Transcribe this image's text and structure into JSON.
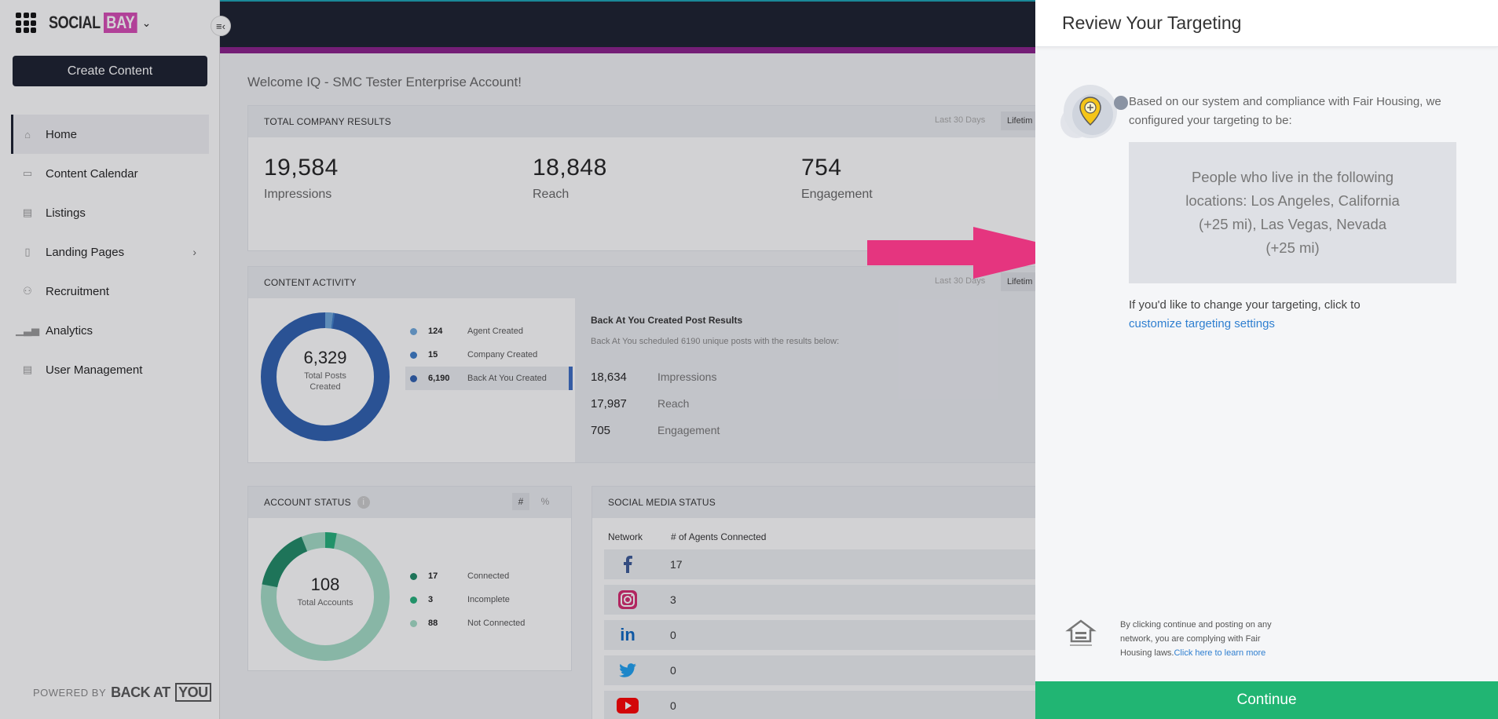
{
  "brand": {
    "name": "SOCIAL",
    "name_accent": "BAY"
  },
  "sidebar": {
    "create_label": "Create Content",
    "items": [
      {
        "label": "Home",
        "icon": "home-icon"
      },
      {
        "label": "Content Calendar",
        "icon": "calendar-icon"
      },
      {
        "label": "Listings",
        "icon": "listings-icon"
      },
      {
        "label": "Landing Pages",
        "icon": "page-icon"
      },
      {
        "label": "Recruitment",
        "icon": "add-user-icon"
      },
      {
        "label": "Analytics",
        "icon": "bar-chart-icon"
      },
      {
        "label": "User Management",
        "icon": "users-icon"
      }
    ],
    "powered_by": "POWERED BY",
    "powered_back": "BACK AT",
    "powered_you": "YOU"
  },
  "main": {
    "welcome": "Welcome IQ - SMC Tester Enterprise Account!",
    "company_results": {
      "title": "TOTAL COMPANY RESULTS",
      "range": "Last 30 Days",
      "range_btn": "Lifetim",
      "stats": [
        {
          "value": "19,584",
          "label": "Impressions"
        },
        {
          "value": "18,848",
          "label": "Reach"
        },
        {
          "value": "754",
          "label": "Engagement"
        }
      ]
    },
    "content_activity": {
      "title": "CONTENT ACTIVITY",
      "range": "Last 30 Days",
      "range_btn": "Lifetim",
      "total": "6,329",
      "total_label_1": "Total Posts",
      "total_label_2": "Created",
      "legend": [
        {
          "value": "124",
          "label": "Agent Created",
          "color": "#6fa8dc"
        },
        {
          "value": "15",
          "label": "Company Created",
          "color": "#3d7cc9"
        },
        {
          "value": "6,190",
          "label": "Back At You Created",
          "color": "#2d5faf"
        }
      ],
      "results_title": "Back At You Created Post Results",
      "results_sub": "Back At You scheduled 6190 unique posts with the results below:",
      "results": [
        {
          "value": "18,634",
          "label": "Impressions"
        },
        {
          "value": "17,987",
          "label": "Reach"
        },
        {
          "value": "705",
          "label": "Engagement"
        }
      ]
    },
    "account_status": {
      "title": "ACCOUNT STATUS",
      "tab_hash": "#",
      "tab_pct": "%",
      "total": "108",
      "total_label": "Total Accounts",
      "legend": [
        {
          "value": "17",
          "label": "Connected",
          "color": "#1e8a66"
        },
        {
          "value": "3",
          "label": "Incomplete",
          "color": "#22b07a"
        },
        {
          "value": "88",
          "label": "Not Connected",
          "color": "#a3dcc6"
        }
      ]
    },
    "social_status": {
      "title": "SOCIAL MEDIA STATUS",
      "col_network": "Network",
      "col_agents": "# of Agents Connected",
      "rows": [
        {
          "network": "facebook-icon",
          "count": "17"
        },
        {
          "network": "instagram-icon",
          "count": "3"
        },
        {
          "network": "linkedin-icon",
          "count": "0"
        },
        {
          "network": "twitter-icon",
          "count": "0"
        },
        {
          "network": "youtube-icon",
          "count": "0"
        }
      ]
    }
  },
  "panel": {
    "title": "Review Your Targeting",
    "intro": "Based on our system and compliance with Fair Housing, we configured your targeting to be:",
    "targeting": "People who live in the following locations: Los Angeles, California (+25 mi), Las Vegas, Nevada (+25 mi)",
    "change_text": "If you'd like to change your targeting, click to",
    "change_link": "customize targeting settings",
    "disclaimer": "By clicking continue and posting on any network, you are complying with Fair Housing laws.",
    "disclaimer_link": "Click here to learn more",
    "continue_label": "Continue"
  },
  "colors": {
    "accent_green": "#21b573",
    "arrow": "#e5357f",
    "dark": "#1a1e2e"
  }
}
